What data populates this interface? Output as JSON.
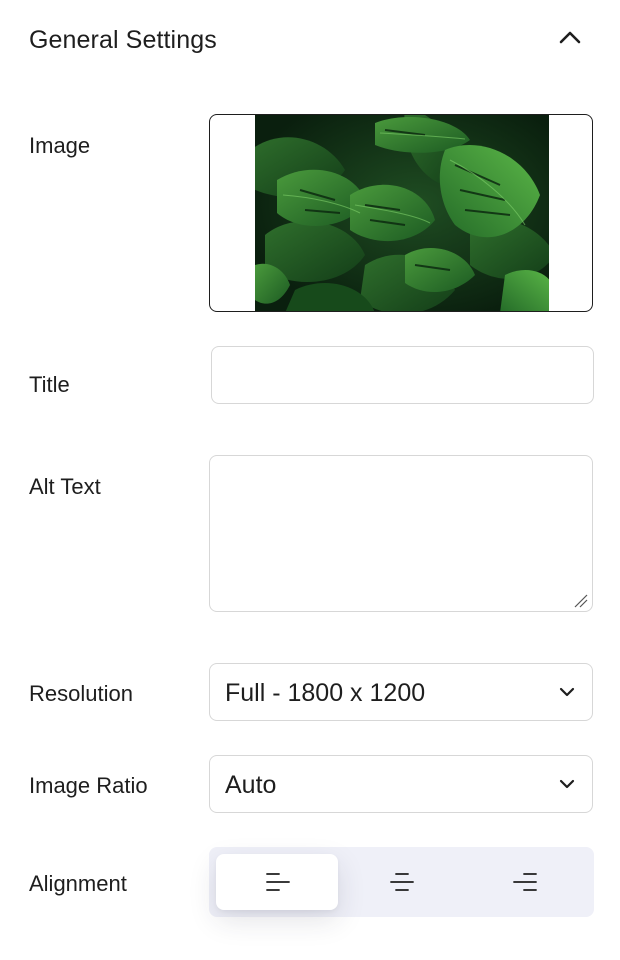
{
  "header": {
    "title": "General Settings",
    "toggle_icon": "chevron-up-icon"
  },
  "image": {
    "label": "Image",
    "preview_description": "monstera-leaves"
  },
  "title_field": {
    "label": "Title",
    "value": "",
    "placeholder": ""
  },
  "alt_text": {
    "label": "Alt Text",
    "value": "",
    "placeholder": ""
  },
  "resolution": {
    "label": "Resolution",
    "value": "Full - 1800 x 1200",
    "icon": "chevron-down-icon"
  },
  "image_ratio": {
    "label": "Image Ratio",
    "value": "Auto",
    "icon": "chevron-down-icon"
  },
  "alignment": {
    "label": "Alignment",
    "options": [
      "align-left-icon",
      "align-center-icon",
      "align-right-icon"
    ],
    "selected_index": 0
  },
  "colors": {
    "text": "#1e1e1e",
    "border": "#d7d7d7",
    "image_border": "#1e1e1e",
    "alignment_track": "#eff0f8",
    "leaf_dark": "#0f2a14",
    "leaf_green": "#2f7a2e"
  }
}
